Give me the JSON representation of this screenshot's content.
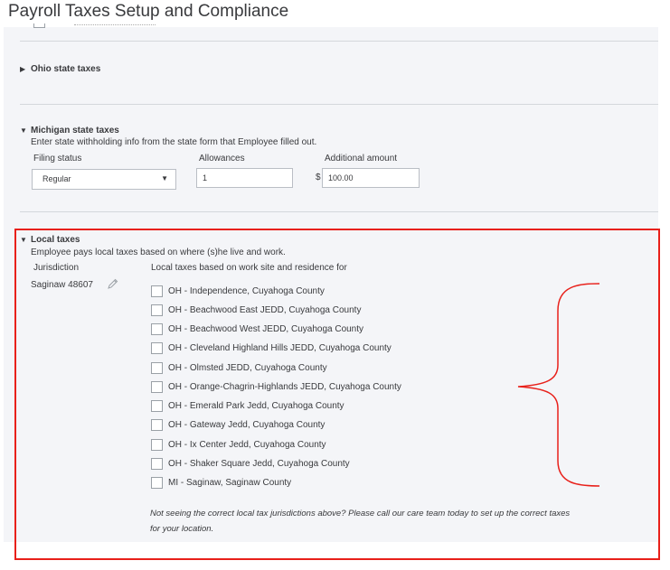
{
  "title": "Payroll Taxes Setup and Compliance",
  "ohio": {
    "heading": "Ohio state taxes"
  },
  "michigan": {
    "heading": "Michigan state taxes",
    "description": "Enter state withholding info from the state form that Employee filled out.",
    "filing_status_label": "Filing status",
    "filing_status_value": "Regular",
    "allowances_label": "Allowances",
    "allowances_value": "1",
    "additional_amount_label": "Additional amount",
    "currency_symbol": "$",
    "additional_amount_value": "100.00"
  },
  "local": {
    "heading": "Local taxes",
    "description": "Employee pays local taxes based on where (s)he live and work.",
    "jurisdiction_label": "Jurisdiction",
    "jurisdiction_value": "Saginaw 48607",
    "list_label": "Local taxes based on work site and residence for",
    "items": [
      {
        "label": "OH - Independence, Cuyahoga County",
        "checked": false
      },
      {
        "label": "OH - Beachwood East JEDD, Cuyahoga County",
        "checked": false
      },
      {
        "label": "OH - Beachwood West JEDD, Cuyahoga County",
        "checked": false
      },
      {
        "label": "OH - Cleveland Highland Hills JEDD, Cuyahoga County",
        "checked": false
      },
      {
        "label": "OH - Olmsted JEDD, Cuyahoga County",
        "checked": false
      },
      {
        "label": "OH - Orange-Chagrin-Highlands JEDD, Cuyahoga County",
        "checked": false
      },
      {
        "label": "OH - Emerald Park Jedd, Cuyahoga County",
        "checked": false
      },
      {
        "label": "OH - Gateway Jedd, Cuyahoga County",
        "checked": false
      },
      {
        "label": "OH - Ix Center Jedd, Cuyahoga County",
        "checked": false
      },
      {
        "label": "OH - Shaker Square Jedd, Cuyahoga County",
        "checked": false
      },
      {
        "label": "MI - Saginaw, Saginaw County",
        "checked": false
      }
    ],
    "note_line1": "Not seeing the correct local tax jurisdictions above? Please call our care team today to set up the correct taxes",
    "note_line2": "for your location."
  },
  "icons": {
    "collapsed_caret": "caret-right-icon",
    "expanded_caret": "caret-down-icon",
    "select_arrow": "chevron-down-icon",
    "edit": "pencil-icon"
  },
  "colors": {
    "annotation": "#e8201a",
    "panel_background": "#f4f5f8",
    "text": "#393a3d"
  }
}
